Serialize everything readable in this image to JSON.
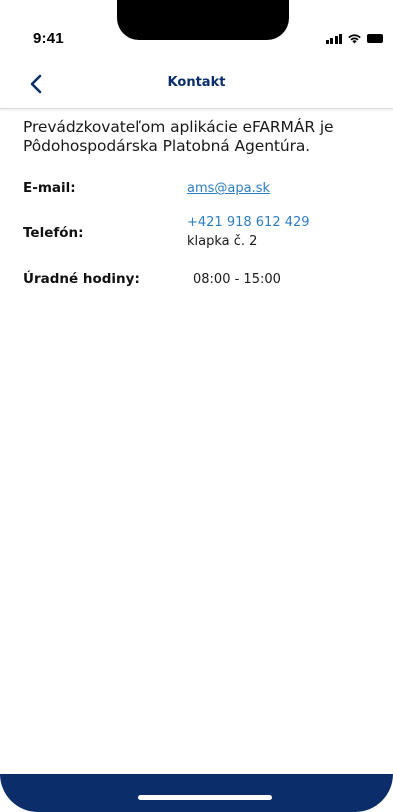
{
  "status_bar": {
    "time": "9:41",
    "icons": [
      "signal-icon",
      "wifi-icon",
      "battery-icon"
    ]
  },
  "nav": {
    "back_icon": "chevron-left-icon",
    "title": "Kontakt",
    "accent_color": "#0b2e6b"
  },
  "intro_text": "Prevádzkovateľom aplikácie eFARMÁR je Pôdohospodárska Platobná Agentúra.",
  "contact": {
    "email": {
      "label": "E-mail:",
      "value": "ams@apa.sk"
    },
    "phone": {
      "label": "Telefón:",
      "value": "+421 918 612 429",
      "extension": "klapka č. 2"
    },
    "hours": {
      "label": "Úradné hodiny:",
      "value": "08:00 - 15:00"
    }
  },
  "colors": {
    "link": "#2f7ec2",
    "brand_navy": "#0b2e6b"
  }
}
